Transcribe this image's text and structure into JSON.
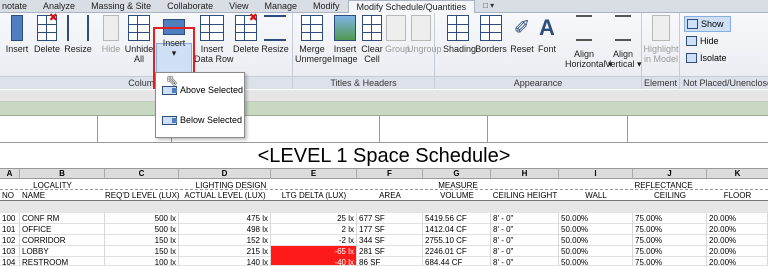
{
  "tabs": [
    "notate",
    "Analyze",
    "Massing & Site",
    "Collaborate",
    "View",
    "Manage",
    "Modify",
    "Modify Schedule/Quantities"
  ],
  "tab_extra": "□ ▾",
  "ribbon": {
    "columns_panel": "Columns",
    "titles_panel": "Titles & Headers",
    "appearance_panel": "Appearance",
    "element_panel": "Element",
    "notplaced_panel": "Not Placed/Unenclosed",
    "col_buttons": [
      {
        "label": "Insert",
        "icon": "insert-column-icon"
      },
      {
        "label": "Delete",
        "icon": "delete-column-icon"
      },
      {
        "label": "Resize",
        "icon": "resize-column-icon"
      },
      {
        "label": "Hide",
        "icon": "hide-column-icon"
      },
      {
        "label": "Unhide",
        "label2": "All",
        "icon": "unhide-all-icon"
      }
    ],
    "row_buttons": [
      {
        "label": "Insert",
        "label2": "▾",
        "icon": "insert-row-icon"
      },
      {
        "label": "Insert",
        "label2": "Data Row",
        "icon": "insert-data-row-icon"
      },
      {
        "label": "Delete",
        "icon": "delete-row-icon"
      },
      {
        "label": "Resize",
        "icon": "resize-row-icon"
      }
    ],
    "title_buttons": [
      {
        "label": "Merge",
        "label2": "Unmerge",
        "icon": "merge-icon"
      },
      {
        "label": "Insert",
        "label2": "Image",
        "icon": "insert-image-icon"
      },
      {
        "label": "Clear",
        "label2": "Cell",
        "icon": "clear-cell-icon"
      },
      {
        "label": "Group",
        "icon": "group-icon"
      },
      {
        "label": "Ungroup",
        "icon": "ungroup-icon"
      }
    ],
    "appearance_buttons": [
      {
        "label": "Shading",
        "icon": "shading-icon"
      },
      {
        "label": "Borders",
        "icon": "borders-icon"
      },
      {
        "label": "Reset",
        "icon": "reset-icon"
      },
      {
        "label": "Font",
        "icon": "font-icon"
      },
      {
        "label": "Align",
        "label2": "Horizontal ▾",
        "icon": "align-horizontal-icon"
      },
      {
        "label": "Align",
        "label2": "Vertical ▾",
        "icon": "align-vertical-icon"
      }
    ],
    "element_button": {
      "label": "Highlight",
      "label2": "in Model",
      "icon": "highlight-in-model-icon"
    },
    "side_buttons": [
      {
        "label": "Show",
        "icon": "show-icon"
      },
      {
        "label": "Hide",
        "icon": "hide-icon"
      },
      {
        "label": "Isolate",
        "icon": "isolate-icon"
      }
    ]
  },
  "dropdown": {
    "items": [
      {
        "label": "Above Selected",
        "icon": "insert-above-icon"
      },
      {
        "label": "Below Selected",
        "icon": "insert-below-icon"
      }
    ]
  },
  "schedule": {
    "title": "<LEVEL 1 Space Schedule>",
    "letters": [
      "A",
      "B",
      "C",
      "D",
      "E",
      "F",
      "G",
      "H",
      "I",
      "J",
      "K"
    ],
    "groups": [
      "LOCALITY",
      "LIGHTING DESIGN",
      "MEASURE",
      "REFLECTANCE"
    ],
    "headers": [
      "NO",
      "NAME",
      "REQ'D LEVEL (LUX)",
      "ACTUAL LEVEL (LUX)",
      "LTG DELTA (LUX)",
      "AREA",
      "VOLUME",
      "CEILING HEIGHT",
      "WALL",
      "CEILING",
      "FLOOR"
    ],
    "rows": [
      [
        "100",
        "CONF RM",
        "500 lx",
        "475 lx",
        "25 lx",
        "677 SF",
        "5419.56 CF",
        "8' - 0\"",
        "50.00%",
        "75.00%",
        "20.00%"
      ],
      [
        "101",
        "OFFICE",
        "500 lx",
        "498 lx",
        "2 lx",
        "177 SF",
        "1412.04 CF",
        "8' - 0\"",
        "50.00%",
        "75.00%",
        "20.00%"
      ],
      [
        "102",
        "CORRIDOR",
        "150 lx",
        "152 lx",
        "-2 lx",
        "344 SF",
        "2755.10 CF",
        "8' - 0\"",
        "50.00%",
        "75.00%",
        "20.00%"
      ],
      [
        "103",
        "LOBBY",
        "150 lx",
        "215 lx",
        "-65 lx",
        "281 SF",
        "2246.01 CF",
        "8' - 0\"",
        "50.00%",
        "75.00%",
        "20.00%"
      ],
      [
        "104",
        "RESTROOM",
        "100 lx",
        "140 lx",
        "-40 lx",
        "86 SF",
        "684.44 CF",
        "8' - 0\"",
        "50.00%",
        "75.00%",
        "20.00%"
      ]
    ],
    "alert_color": "#ff1a1a"
  }
}
